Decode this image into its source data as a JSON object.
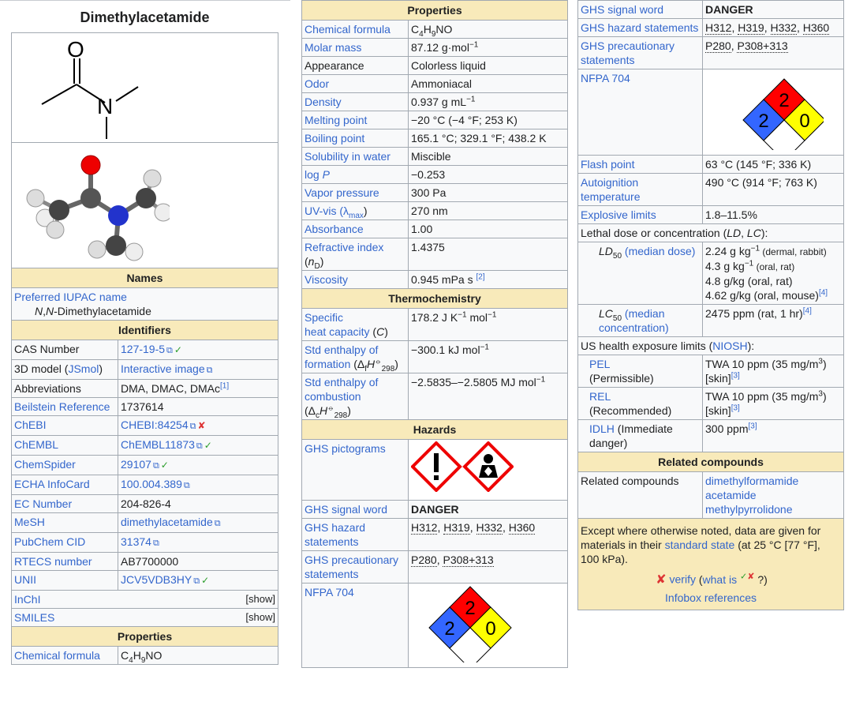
{
  "title": "Dimethylacetamide",
  "names": {
    "header": "Names",
    "iupac_label": "Preferred IUPAC name",
    "iupac_value": "N,N-Dimethylacetamide"
  },
  "identifiers": {
    "header": "Identifiers",
    "cas_label": "CAS Number",
    "cas_value": "127-19-5",
    "jmol_label_pre": "3D model (",
    "jmol_label_link": "JSmol",
    "jmol_label_post": ")",
    "jmol_value": "Interactive image",
    "abbr_label": "Abbreviations",
    "abbr_value": "DMA, DMAC, DMAc",
    "abbr_ref": "[1]",
    "beil_label": "Beilstein Reference",
    "beil_value": "1737614",
    "chebi_label": "ChEBI",
    "chebi_value": "CHEBI:84254",
    "chembl_label": "ChEMBL",
    "chembl_value": "ChEMBL11873",
    "chemspider_label": "ChemSpider",
    "chemspider_value": "29107",
    "echa_label": "ECHA InfoCard",
    "echa_value": "100.004.389",
    "ec_label": "EC Number",
    "ec_value": "204-826-4",
    "mesh_label": "MeSH",
    "mesh_value": "dimethylacetamide",
    "pubchem_label": "PubChem CID",
    "pubchem_value": "31374",
    "rtecs_label": "RTECS number",
    "rtecs_value": "AB7700000",
    "unii_label": "UNII",
    "unii_value": "JCV5VDB3HY",
    "inchi_label": "InChI",
    "smiles_label": "SMILES",
    "show": "[show]"
  },
  "properties": {
    "header": "Properties",
    "formula_label": "Chemical formula",
    "formula_C": "C",
    "formula_4": "4",
    "formula_H": "H",
    "formula_9": "9",
    "formula_NO": "NO",
    "molar_label": "Molar mass",
    "molar_value": "87.12 g·mol",
    "molar_sup": "−1",
    "appearance_label": "Appearance",
    "appearance_value": "Colorless liquid",
    "odor_label": "Odor",
    "odor_value": "Ammoniacal",
    "density_label": "Density",
    "density_value": "0.937 g mL",
    "density_sup": "−1",
    "melting_label": "Melting point",
    "melting_value": "−20 °C (−4 °F; 253 K)",
    "boiling_label": "Boiling point",
    "boiling_value": "165.1 °C; 329.1 °F; 438.2 K",
    "solubility_label": "Solubility in water",
    "solubility_value": "Miscible",
    "logp_label": "log P",
    "logp_value": "−0.253",
    "vapor_label": "Vapor pressure",
    "vapor_value": "300 Pa",
    "uv_label": "UV-vis (λ",
    "uv_sub": "max",
    "uv_close": ")",
    "uv_value": "270 nm",
    "absorbance_label": "Absorbance",
    "absorbance_value": "1.00",
    "refr_label": "Refractive index (n",
    "refr_sub": "D",
    "refr_close": ")",
    "refr_value": "1.4375",
    "visc_label": "Viscosity",
    "visc_value": "0.945 mPa s",
    "visc_ref": "[2]"
  },
  "thermo": {
    "header": "Thermochemistry",
    "heatcap_label": "Specific heat capacity (C)",
    "heatcap_value": "178.2 J K",
    "heatcap_sup1": "−1",
    "heatcap_mid": " mol",
    "heatcap_sup2": "−1",
    "enthf_label": "Std enthalpy of formation (Δ",
    "enthf_sub1": "f",
    "enthf_h": "H",
    "enthf_sup": "⦵",
    "enthf_sub2": "298",
    "enthf_close": ")",
    "enthf_value": "−300.1 kJ mol",
    "enthf_vsup": "−1",
    "enthc_label": "Std enthalpy of combustion (Δ",
    "enthc_sub1": "c",
    "enthc_h": "H",
    "enthc_sup": "⦵",
    "enthc_sub2": "298",
    "enthc_close": ")",
    "enthc_value": "−2.5835–−2.5805 MJ mol",
    "enthc_vsup": "−1"
  },
  "hazards": {
    "header": "Hazards",
    "pictograms_label": "GHS pictograms",
    "signal_label": "GHS signal word",
    "signal_value": "DANGER",
    "hazard_label": "GHS hazard statements",
    "hazard_codes": [
      "H312",
      "H319",
      "H332",
      "H360"
    ],
    "precaution_label": "GHS precautionary statements",
    "precaution_codes": [
      "P280",
      "P308+313"
    ],
    "nfpa_label": "NFPA 704",
    "nfpa_health": "2",
    "nfpa_fire": "2",
    "nfpa_reactivity": "0",
    "flash_label": "Flash point",
    "flash_value": "63 °C (145 °F; 336 K)",
    "autoign_label": "Autoignition temperature",
    "autoign_value": "490 °C (914 °F; 763 K)",
    "explosive_label": "Explosive limits",
    "explosive_value": "1.8–11.5%",
    "lethal_header": "Lethal dose or concentration (LD, LC):",
    "ld50_label_pre": "LD",
    "ld50_sub": "50",
    "ld50_label_link": " (median dose)",
    "ld50_values": [
      {
        "main": "2.24 g kg",
        "sup": "−1",
        "note": " (dermal, rabbit)",
        "ref": ""
      },
      {
        "main": "4.3 g kg",
        "sup": "−1",
        "note": " (oral, rat)",
        "ref": ""
      },
      {
        "main": "4.8 g/kg (oral, rat)",
        "sup": "",
        "note": "",
        "ref": ""
      },
      {
        "main": "4.62 g/kg (oral, mouse)",
        "sup": "",
        "note": "",
        "ref": "[4]"
      }
    ],
    "lc50_label_pre": "LC",
    "lc50_sub": "50",
    "lc50_label_link": " (median concentration)",
    "lc50_value": "2475 ppm (rat, 1 hr)",
    "lc50_ref": "[4]",
    "us_header_pre": "US health exposure limits (",
    "us_header_link": "NIOSH",
    "us_header_post": "):",
    "pel_label": "PEL",
    "pel_sub": "(Permissible)",
    "pel_value": "TWA 10 ppm (35 mg/m",
    "pel_sup": "3",
    "pel_close": ")",
    "pel_skin": "[skin]",
    "pel_ref": "[3]",
    "rel_label": "REL",
    "rel_sub": "(Recommended)",
    "rel_value": "TWA 10 ppm (35 mg/m",
    "rel_sup": "3",
    "rel_close": ")",
    "rel_skin": "[skin]",
    "rel_ref": "[3]",
    "idlh_label": "IDLH",
    "idlh_sub": " (Immediate danger)",
    "idlh_value": "300 ppm",
    "idlh_ref": "[3]"
  },
  "related": {
    "header": "Related compounds",
    "label": "Related compounds",
    "items": [
      "dimethylformamide",
      "acetamide",
      "methylpyrrolidone"
    ]
  },
  "footer": {
    "note_pre": "Except where otherwise noted, data are given for materials in their ",
    "note_link": "standard state",
    "note_post": " (at 25 °C [77 °F], 100 kPa).",
    "verify": "verify",
    "what_pre": "(what is ",
    "what_post": "?)",
    "refs": "Infobox references"
  },
  "colors": {
    "accent": "#3366cc",
    "section": "#f8eaba",
    "border": "#a2a9b1"
  }
}
